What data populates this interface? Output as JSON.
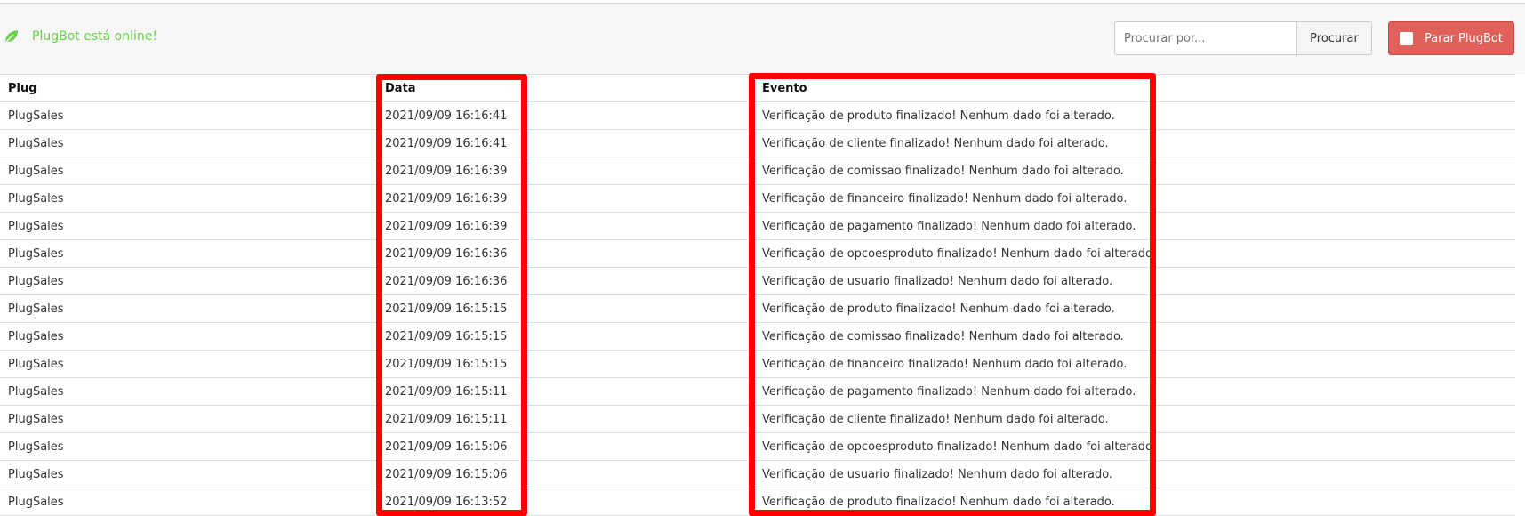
{
  "status": {
    "text": "PlugBot está online!",
    "icon": "leaf-icon",
    "color": "#6ccf4e"
  },
  "search": {
    "placeholder": "Procurar por...",
    "value": "",
    "button_label": "Procurar"
  },
  "stop_button": {
    "label": "Parar PlugBot",
    "icon": "stop-icon",
    "color": "#e0605a"
  },
  "table": {
    "headers": [
      "Plug",
      "Data",
      "Evento"
    ],
    "rows": [
      [
        "PlugSales",
        "2021/09/09 16:16:41",
        "Verificação de produto finalizado! Nenhum dado foi alterado."
      ],
      [
        "PlugSales",
        "2021/09/09 16:16:41",
        "Verificação de cliente finalizado! Nenhum dado foi alterado."
      ],
      [
        "PlugSales",
        "2021/09/09 16:16:39",
        "Verificação de comissao finalizado! Nenhum dado foi alterado."
      ],
      [
        "PlugSales",
        "2021/09/09 16:16:39",
        "Verificação de financeiro finalizado! Nenhum dado foi alterado."
      ],
      [
        "PlugSales",
        "2021/09/09 16:16:39",
        "Verificação de pagamento finalizado! Nenhum dado foi alterado."
      ],
      [
        "PlugSales",
        "2021/09/09 16:16:36",
        "Verificação de opcoesproduto finalizado! Nenhum dado foi alterado."
      ],
      [
        "PlugSales",
        "2021/09/09 16:16:36",
        "Verificação de usuario finalizado! Nenhum dado foi alterado."
      ],
      [
        "PlugSales",
        "2021/09/09 16:15:15",
        "Verificação de produto finalizado! Nenhum dado foi alterado."
      ],
      [
        "PlugSales",
        "2021/09/09 16:15:15",
        "Verificação de comissao finalizado! Nenhum dado foi alterado."
      ],
      [
        "PlugSales",
        "2021/09/09 16:15:15",
        "Verificação de financeiro finalizado! Nenhum dado foi alterado."
      ],
      [
        "PlugSales",
        "2021/09/09 16:15:11",
        "Verificação de pagamento finalizado! Nenhum dado foi alterado."
      ],
      [
        "PlugSales",
        "2021/09/09 16:15:11",
        "Verificação de cliente finalizado! Nenhum dado foi alterado."
      ],
      [
        "PlugSales",
        "2021/09/09 16:15:06",
        "Verificação de opcoesproduto finalizado! Nenhum dado foi alterado."
      ],
      [
        "PlugSales",
        "2021/09/09 16:15:06",
        "Verificação de usuario finalizado! Nenhum dado foi alterado."
      ],
      [
        "PlugSales",
        "2021/09/09 16:13:52",
        "Verificação de produto finalizado! Nenhum dado foi alterado."
      ]
    ]
  },
  "annotations": {
    "highlight_color": "#ff0000"
  }
}
